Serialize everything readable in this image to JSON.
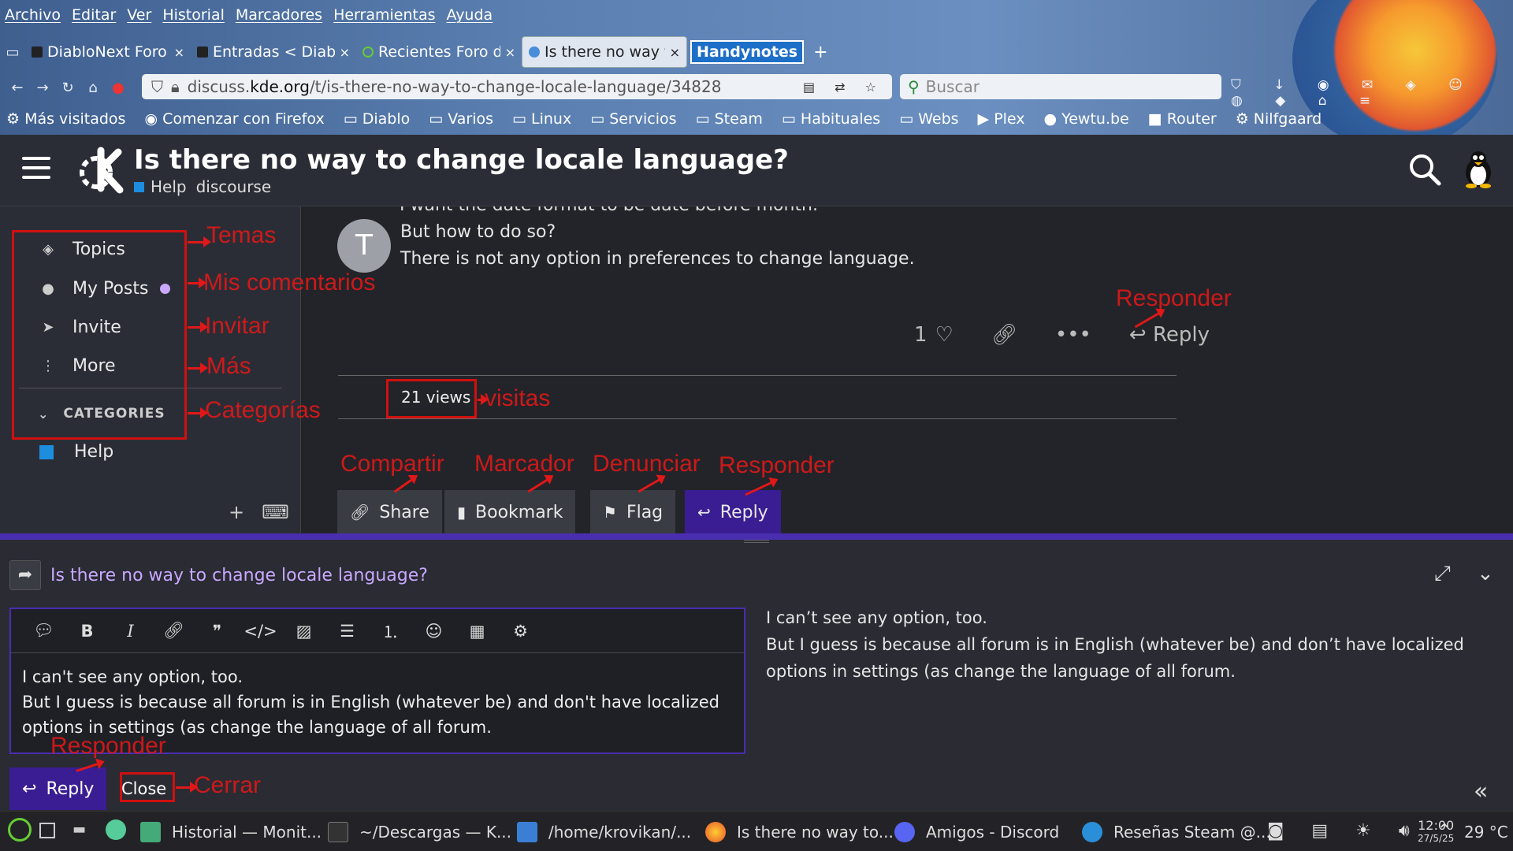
{
  "browser": {
    "menu": [
      "Archivo",
      "Editar",
      "Ver",
      "Historial",
      "Marcadores",
      "Herramientas",
      "Ayuda"
    ],
    "tabs": [
      {
        "title": "DiabloNext Foro",
        "active": false
      },
      {
        "title": "Entradas < Diabl",
        "active": false
      },
      {
        "title": "Recientes Foro d",
        "active": false
      },
      {
        "title": "Is there no way t",
        "active": true
      }
    ],
    "handynotes": "Handynotes",
    "url_prefix": "discuss.",
    "url_host": "kde.org",
    "url_path": "/t/is-there-no-way-to-change-locale-language/34828",
    "search_placeholder": "Buscar",
    "bookmarks": [
      "Más visitados",
      "Comenzar con Firefox",
      "Diablo",
      "Varios",
      "Linux",
      "Servicios",
      "Steam",
      "Habituales",
      "Webs",
      "Plex",
      "Yewtu.be",
      "Router",
      "Nilfgaard"
    ]
  },
  "header": {
    "title": "Is there no way to change locale language?",
    "category": "Help",
    "tag": "discourse"
  },
  "sidebar": {
    "items": [
      {
        "label": "Topics",
        "icon": "layers-icon"
      },
      {
        "label": "My Posts",
        "icon": "user-icon"
      },
      {
        "label": "Invite",
        "icon": "paper-plane-icon"
      },
      {
        "label": "More",
        "icon": "vertical-dots-icon"
      }
    ],
    "categories_heading": "CATEGORIES",
    "categories": [
      {
        "label": "Help",
        "color": "#1d8de0"
      }
    ]
  },
  "post": {
    "avatar_letter": "T",
    "clipped_line": "I want the date format to be date before month.",
    "lines": [
      "But how to do so?",
      "There is not any option in preferences to change language."
    ],
    "likes": "1",
    "reply_label": "Reply"
  },
  "topic": {
    "views": "21 views",
    "buttons": {
      "share": "Share",
      "bookmark": "Bookmark",
      "flag": "Flag",
      "reply": "Reply"
    }
  },
  "composer": {
    "title": "Is there no way to change locale language?",
    "editor_lines": [
      "I can't see any option, too.",
      "But I guess is because all forum is in English (whatever be) and don't have localized",
      "options in settings (as change the language of all forum."
    ],
    "preview_lines": [
      "I can’t see any option, too.",
      "But I guess is because all forum is in English (whatever be) and don’t have localized",
      "options in settings (as change the language of all forum."
    ],
    "reply_button": "Reply",
    "close_button": "Close"
  },
  "annotations": {
    "temas": "Temas",
    "mis_comentarios": "Mis comentarios",
    "invitar": "Invitar",
    "mas": "Más",
    "categorias": "Categorías",
    "responder_post": "Responder",
    "visitas": "visitas",
    "compartir": "Compartir",
    "marcador": "Marcador",
    "denunciar": "Denunciar",
    "responder_topic": "Responder",
    "responder_composer": "Responder",
    "cerrar": "Cerrar"
  },
  "taskbar": {
    "apps": [
      "Historial — Monit...",
      "~/Descargas — K...",
      "/home/krovikan/...",
      "Is there no way to...",
      "Amigos - Discord",
      "Reseñas Steam @..."
    ],
    "time": "12:00",
    "date": "27/5/25",
    "temperature": "29 °C"
  },
  "colors": {
    "accent": "#4a2eb0",
    "primary_button": "#3a1d92",
    "annotation_red": "#e01818",
    "category_blue": "#1d8de0",
    "unread_dot": "#c9a8ff"
  }
}
